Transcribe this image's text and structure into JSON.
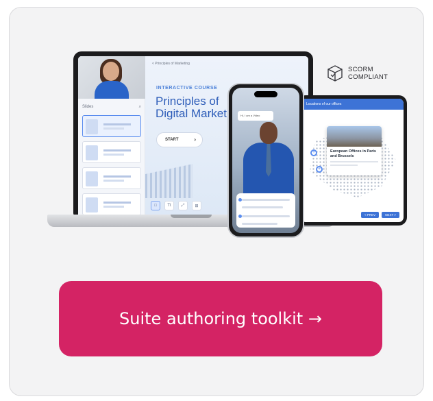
{
  "laptop": {
    "breadcrumb": "< Principles of Marketing",
    "sidebar_search": "Slides",
    "eyebrow": "INTERACTIVE COURSE",
    "title": "Principles of Digital Marketing",
    "start_label": "START",
    "tools": [
      "□",
      "Tt",
      "⤢",
      "⊞"
    ]
  },
  "phone": {
    "bubble": "Hi, I am a Video"
  },
  "tablet": {
    "header": "Locations of our offices",
    "card_title": "European Offices in Paris and Brussels",
    "prev_label": "< PREV",
    "next_label": "NEXT >"
  },
  "badge": {
    "line1": "SCORM",
    "line2": "COMPLIANT",
    "icon": "package-check-icon"
  },
  "cta": {
    "label": "Suite authoring toolkit →"
  },
  "colors": {
    "cta_bg": "#d42364",
    "card_bg": "#f3f3f4",
    "accent_blue": "#3d73d6"
  }
}
